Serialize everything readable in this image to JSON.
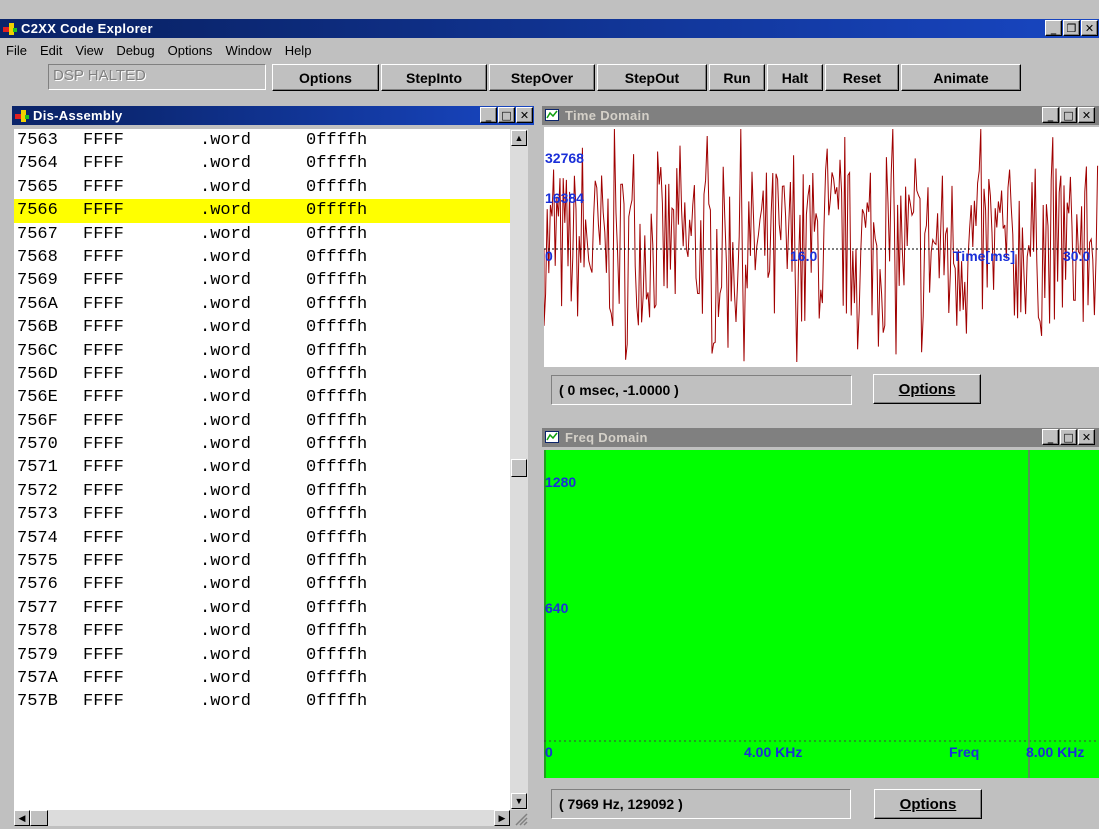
{
  "app": {
    "title": "C2XX Code Explorer"
  },
  "menu": [
    "File",
    "Edit",
    "View",
    "Debug",
    "Options",
    "Window",
    "Help"
  ],
  "toolbar": {
    "status": "DSP HALTED",
    "buttons": [
      "Options",
      "StepInto",
      "StepOver",
      "StepOut",
      "Run",
      "Halt",
      "Reset",
      "Animate"
    ]
  },
  "disassembly": {
    "title": "Dis-Assembly",
    "selected_index": 3,
    "rows": [
      {
        "addr": "7563",
        "op": "FFFF",
        "ins": ".word",
        "arg": "0ffffh"
      },
      {
        "addr": "7564",
        "op": "FFFF",
        "ins": ".word",
        "arg": "0ffffh"
      },
      {
        "addr": "7565",
        "op": "FFFF",
        "ins": ".word",
        "arg": "0ffffh"
      },
      {
        "addr": "7566",
        "op": "FFFF",
        "ins": ".word",
        "arg": "0ffffh"
      },
      {
        "addr": "7567",
        "op": "FFFF",
        "ins": ".word",
        "arg": "0ffffh"
      },
      {
        "addr": "7568",
        "op": "FFFF",
        "ins": ".word",
        "arg": "0ffffh"
      },
      {
        "addr": "7569",
        "op": "FFFF",
        "ins": ".word",
        "arg": "0ffffh"
      },
      {
        "addr": "756A",
        "op": "FFFF",
        "ins": ".word",
        "arg": "0ffffh"
      },
      {
        "addr": "756B",
        "op": "FFFF",
        "ins": ".word",
        "arg": "0ffffh"
      },
      {
        "addr": "756C",
        "op": "FFFF",
        "ins": ".word",
        "arg": "0ffffh"
      },
      {
        "addr": "756D",
        "op": "FFFF",
        "ins": ".word",
        "arg": "0ffffh"
      },
      {
        "addr": "756E",
        "op": "FFFF",
        "ins": ".word",
        "arg": "0ffffh"
      },
      {
        "addr": "756F",
        "op": "FFFF",
        "ins": ".word",
        "arg": "0ffffh"
      },
      {
        "addr": "7570",
        "op": "FFFF",
        "ins": ".word",
        "arg": "0ffffh"
      },
      {
        "addr": "7571",
        "op": "FFFF",
        "ins": ".word",
        "arg": "0ffffh"
      },
      {
        "addr": "7572",
        "op": "FFFF",
        "ins": ".word",
        "arg": "0ffffh"
      },
      {
        "addr": "7573",
        "op": "FFFF",
        "ins": ".word",
        "arg": "0ffffh"
      },
      {
        "addr": "7574",
        "op": "FFFF",
        "ins": ".word",
        "arg": "0ffffh"
      },
      {
        "addr": "7575",
        "op": "FFFF",
        "ins": ".word",
        "arg": "0ffffh"
      },
      {
        "addr": "7576",
        "op": "FFFF",
        "ins": ".word",
        "arg": "0ffffh"
      },
      {
        "addr": "7577",
        "op": "FFFF",
        "ins": ".word",
        "arg": "0ffffh"
      },
      {
        "addr": "7578",
        "op": "FFFF",
        "ins": ".word",
        "arg": "0ffffh"
      },
      {
        "addr": "7579",
        "op": "FFFF",
        "ins": ".word",
        "arg": "0ffffh"
      },
      {
        "addr": "757A",
        "op": "FFFF",
        "ins": ".word",
        "arg": "0ffffh"
      },
      {
        "addr": "757B",
        "op": "FFFF",
        "ins": ".word",
        "arg": "0ffffh"
      }
    ]
  },
  "time_domain": {
    "title": "Time Domain",
    "readout": "( 0 msec, -1.0000 )",
    "options_label": "Options",
    "y_tick_labels": [
      "32768",
      "16384"
    ],
    "x_tick_labels": [
      "0",
      "16.0",
      "Time[ms]",
      "30.0"
    ],
    "trace_color": "#a00000"
  },
  "freq_domain": {
    "title": "Freq Domain",
    "readout": "( 7969 Hz, 129092 )",
    "options_label": "Options",
    "y_tick_labels": [
      "1280",
      "640"
    ],
    "x_tick_labels": [
      "0",
      "4.00 KHz",
      "Freq",
      "8.00 KHz"
    ],
    "background_color": "#00ff00"
  },
  "colors": {
    "active_title": "#0a246a",
    "inactive_title": "#808080",
    "selection": "#ffff00",
    "axis_text": "#1a2fd8"
  }
}
